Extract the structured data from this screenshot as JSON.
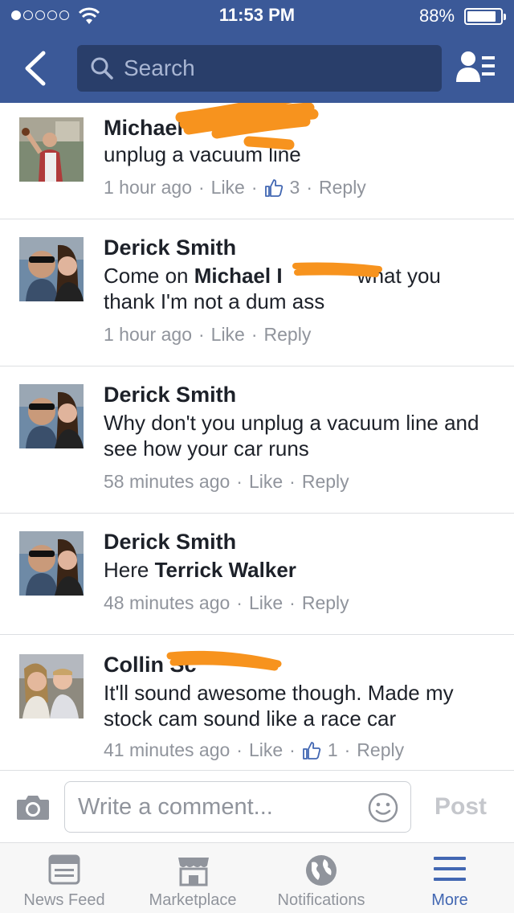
{
  "status_bar": {
    "time": "11:53 PM",
    "battery_pct": "88%",
    "signal_bars_filled": 1,
    "signal_bars_total": 5
  },
  "nav": {
    "back_icon": "chevron-left-icon",
    "search_placeholder": "Search",
    "friends_icon": "friend-list-icon"
  },
  "colors": {
    "brand": "#3b5998",
    "search_bg": "#293e6a",
    "link_blue": "#4267b2",
    "meta_gray": "#90949c",
    "redaction": "#f7931e"
  },
  "comments": [
    {
      "name": "Michael",
      "text": "unplug a vacuum line",
      "time": "1 hour ago",
      "like": "Like",
      "reply": "Reply",
      "like_count": "3"
    },
    {
      "name": "Derick Smith",
      "text_prefix": "Come on",
      "mention": "Michael I",
      "text_suffix": "what you",
      "text_line2": "thank I'm not a dum ass",
      "time": "1 hour ago",
      "like": "Like",
      "reply": "Reply"
    },
    {
      "name": "Derick Smith",
      "text": "Why don't you unplug a vacuum line and see how your car runs",
      "time": "58 minutes ago",
      "like": "Like",
      "reply": "Reply"
    },
    {
      "name": "Derick Smith",
      "text_prefix": "Here",
      "mention": "Terrick Walker",
      "time": "48 minutes ago",
      "like": "Like",
      "reply": "Reply"
    },
    {
      "name": "Collin Sc",
      "text": "It'll sound awesome though. Made my stock cam sound like a race car",
      "time": "41 minutes ago",
      "like": "Like",
      "reply": "Reply",
      "like_count": "1"
    }
  ],
  "composer": {
    "camera_icon": "camera-icon",
    "placeholder": "Write a comment...",
    "emoji_icon": "smiley-icon",
    "post_label": "Post"
  },
  "tabbar": {
    "tabs": [
      {
        "label": "News Feed",
        "icon": "news-feed-icon"
      },
      {
        "label": "Marketplace",
        "icon": "marketplace-icon"
      },
      {
        "label": "Notifications",
        "icon": "globe-icon"
      },
      {
        "label": "More",
        "icon": "menu-icon"
      }
    ],
    "active": "More"
  }
}
